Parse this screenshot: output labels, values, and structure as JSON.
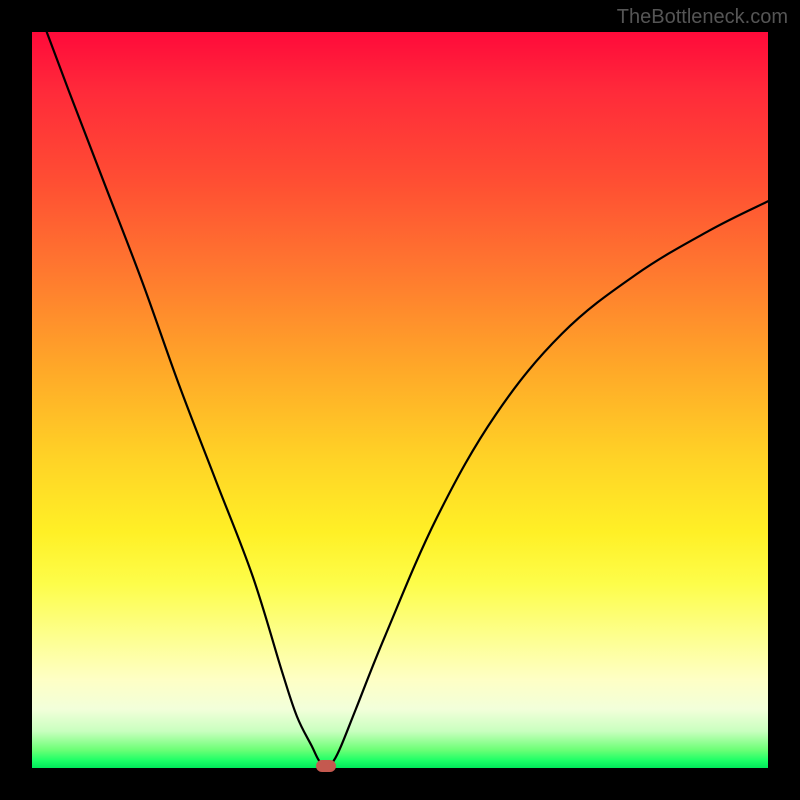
{
  "watermark": "TheBottleneck.com",
  "chart_data": {
    "type": "line",
    "title": "",
    "xlabel": "",
    "ylabel": "",
    "xlim": [
      0,
      100
    ],
    "ylim": [
      0,
      100
    ],
    "background_gradient": {
      "top": "#ff0a3a",
      "bottom": "#00e85a",
      "stops": [
        "red",
        "orange",
        "yellow",
        "green"
      ]
    },
    "series": [
      {
        "name": "bottleneck-curve",
        "x": [
          2,
          5,
          10,
          15,
          20,
          25,
          30,
          34,
          36,
          38,
          39,
          40,
          41,
          42,
          44,
          48,
          55,
          63,
          72,
          82,
          92,
          100
        ],
        "y": [
          100,
          92,
          79,
          66,
          52,
          39,
          26,
          13,
          7,
          3,
          1,
          0,
          1,
          3,
          8,
          18,
          34,
          48,
          59,
          67,
          73,
          77
        ]
      }
    ],
    "marker": {
      "name": "optimal-point",
      "x": 40,
      "y": 0.3,
      "color": "#c4594f"
    }
  }
}
